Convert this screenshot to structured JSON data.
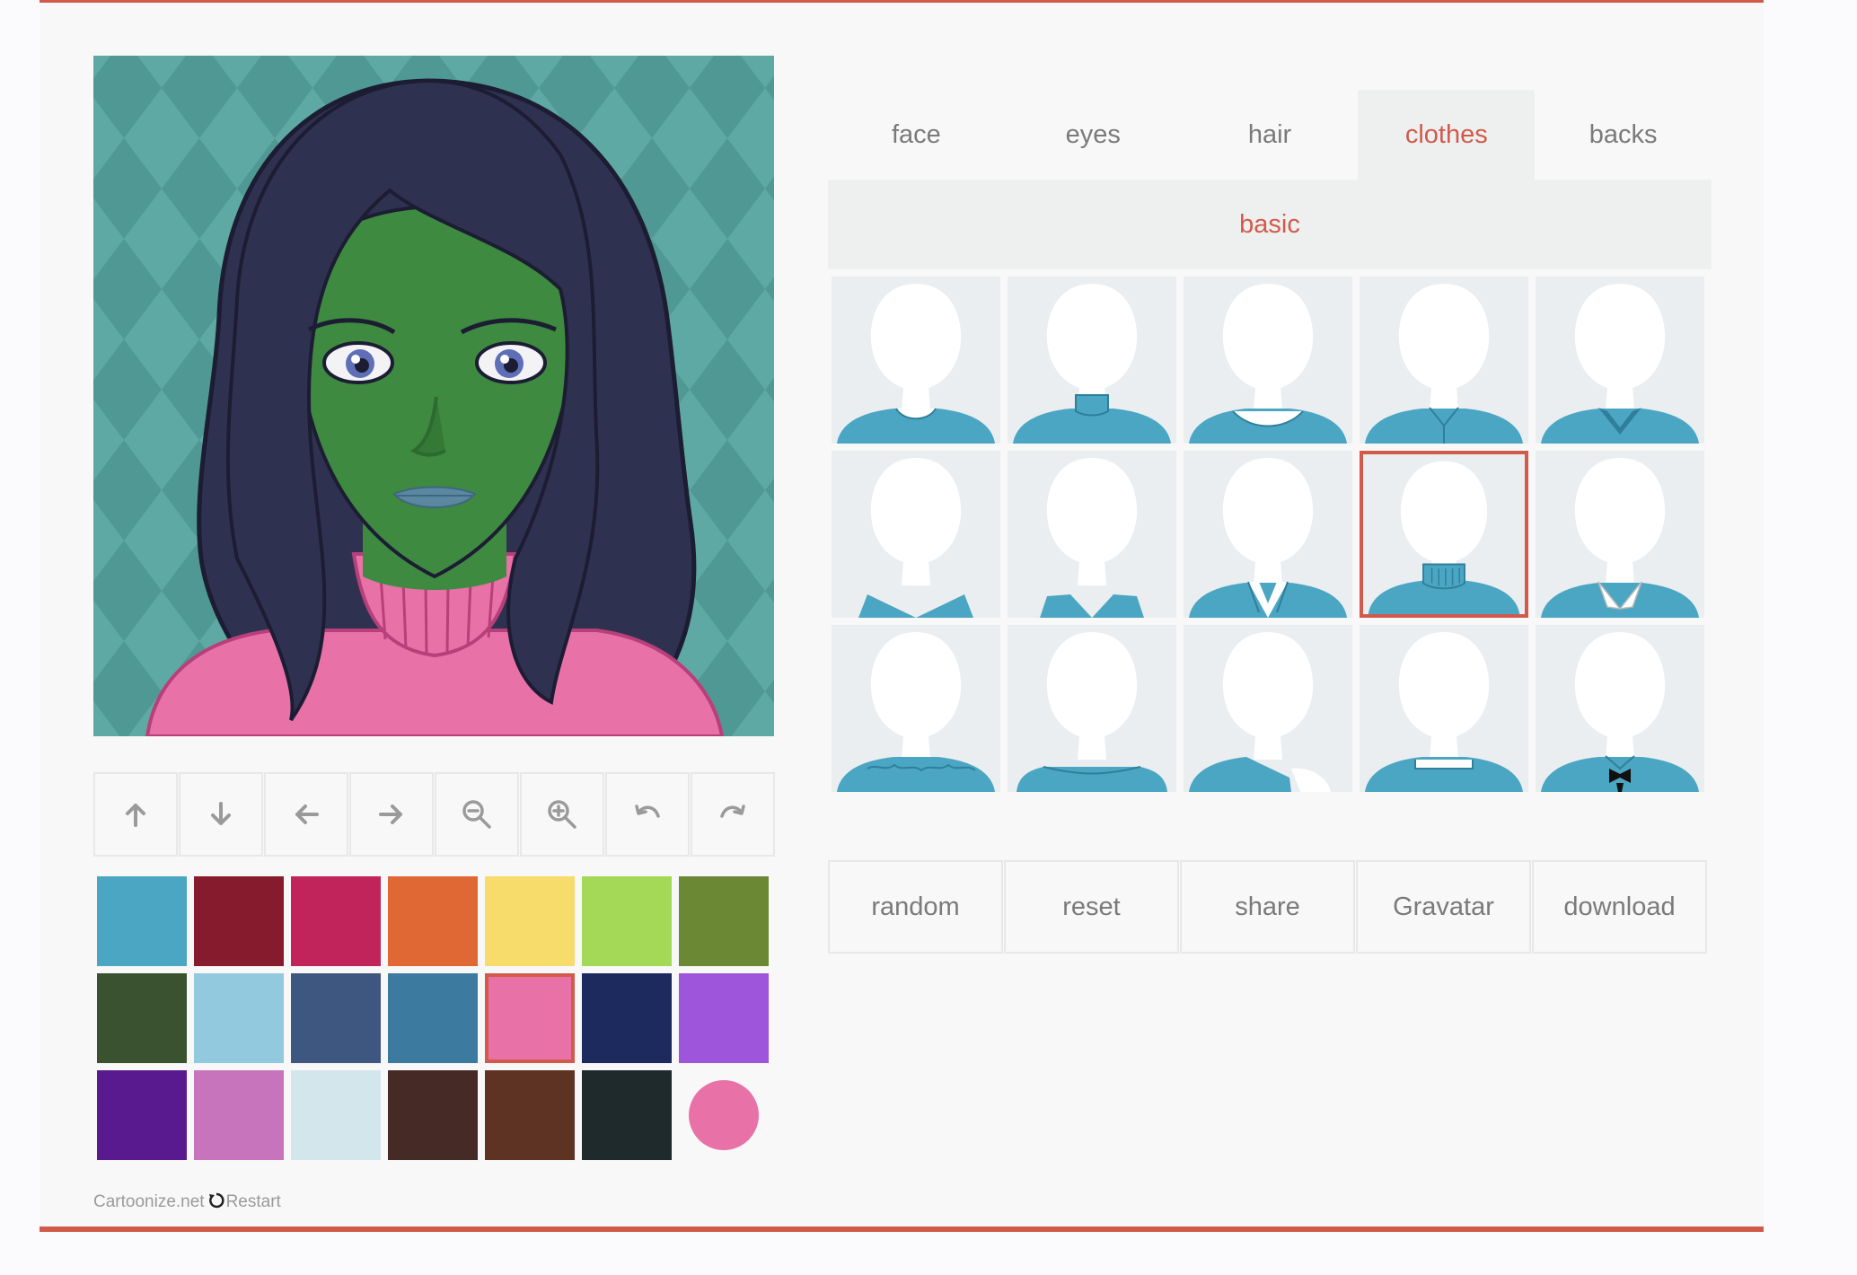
{
  "tabs": [
    {
      "label": "face",
      "active": false
    },
    {
      "label": "eyes",
      "active": false
    },
    {
      "label": "hair",
      "active": false
    },
    {
      "label": "clothes",
      "active": true
    },
    {
      "label": "backs",
      "active": false
    }
  ],
  "subtab": {
    "label": "basic"
  },
  "toolbar": [
    {
      "name": "move-up",
      "icon": "arrow-up-icon"
    },
    {
      "name": "move-down",
      "icon": "arrow-down-icon"
    },
    {
      "name": "move-left",
      "icon": "arrow-left-icon"
    },
    {
      "name": "move-right",
      "icon": "arrow-right-icon"
    },
    {
      "name": "zoom-out",
      "icon": "zoom-out-icon"
    },
    {
      "name": "zoom-in",
      "icon": "zoom-in-icon"
    },
    {
      "name": "undo",
      "icon": "undo-icon"
    },
    {
      "name": "redo",
      "icon": "redo-icon"
    }
  ],
  "palette": {
    "colors": [
      "#4ba6c3",
      "#861b2e",
      "#c0245a",
      "#e06835",
      "#f7dc6b",
      "#a4d957",
      "#6b8834",
      "#3a5230",
      "#93c9df",
      "#3e5780",
      "#3d7aa0",
      "#e872a8",
      "#1c2a5e",
      "#9f55db",
      "#59198f",
      "#c774bc",
      "#d3e6ec",
      "#462a26",
      "#5e3324",
      "#1f2a2c"
    ],
    "selected_index": 11,
    "current_color": "#e872a8"
  },
  "items": {
    "count": 15,
    "selected_index": 8,
    "styles": [
      "crew",
      "high-neck",
      "wide-crew",
      "henley",
      "collar-v",
      "v-neck",
      "deep-v",
      "blazer",
      "turtleneck",
      "white-collar",
      "ruffle",
      "boat",
      "asym",
      "square",
      "bowtie"
    ],
    "cloth_color": "#4ba6c3"
  },
  "actions": [
    {
      "name": "random-button",
      "label": "random"
    },
    {
      "name": "reset-button",
      "label": "reset"
    },
    {
      "name": "share-button",
      "label": "share"
    },
    {
      "name": "gravatar-button",
      "label": "Gravatar"
    },
    {
      "name": "download-button",
      "label": "download"
    }
  ],
  "footer": {
    "brand": "Cartoonize.net",
    "restart": "Restart"
  },
  "colors": {
    "accent": "#d25a4a",
    "skin": "#3e8a40",
    "hair": "#2f3150",
    "sweater": "#e872a8",
    "background": "#5fa9a5"
  }
}
